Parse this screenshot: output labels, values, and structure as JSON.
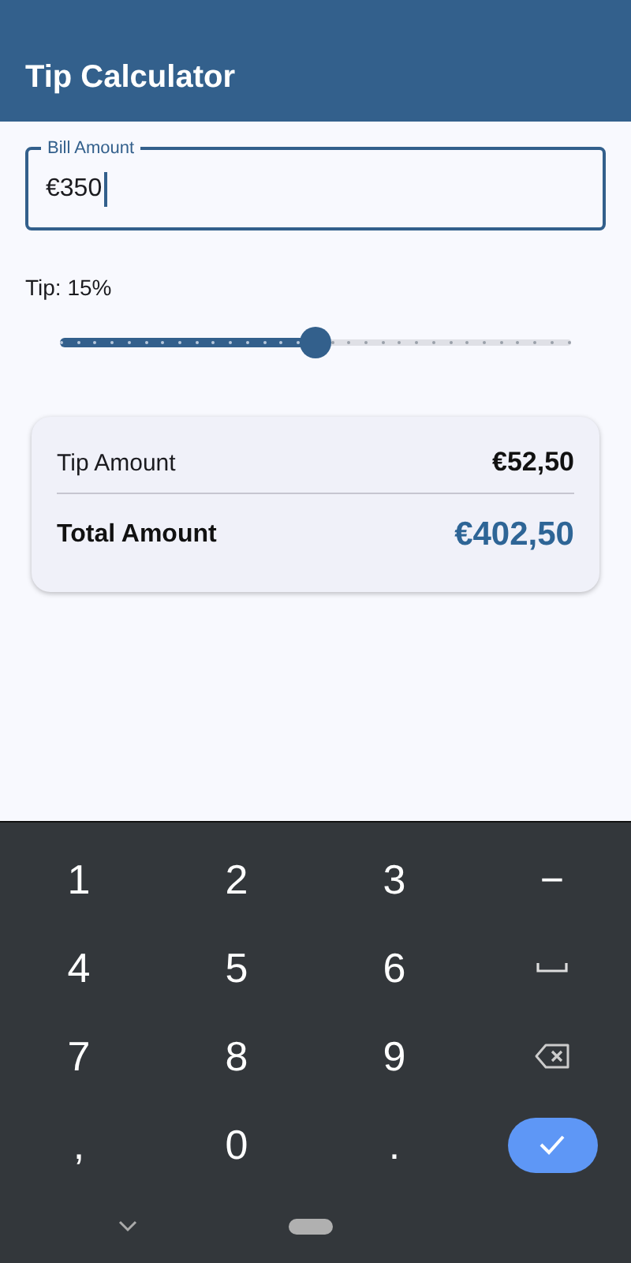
{
  "app_bar": {
    "title": "Tip Calculator"
  },
  "bill_field": {
    "label": "Bill Amount",
    "value": "€350",
    "focused": true
  },
  "tip": {
    "label": "Tip: 15%",
    "slider": {
      "level": 0.5
    }
  },
  "summary": {
    "rows": [
      {
        "kind": "regular",
        "label": "Tip Amount",
        "value": "€52,50"
      },
      {
        "kind": "total",
        "label": "Total Amount",
        "value": "€402,50"
      }
    ]
  },
  "keyboard": {
    "keys": [
      {
        "kind": "char",
        "label": "1"
      },
      {
        "kind": "char",
        "label": "2"
      },
      {
        "kind": "char",
        "label": "3"
      },
      {
        "kind": "char",
        "label": "−"
      },
      {
        "kind": "char",
        "label": "4"
      },
      {
        "kind": "char",
        "label": "5"
      },
      {
        "kind": "char",
        "label": "6"
      },
      {
        "kind": "space"
      },
      {
        "kind": "char",
        "label": "7"
      },
      {
        "kind": "char",
        "label": "8"
      },
      {
        "kind": "char",
        "label": "9"
      },
      {
        "kind": "backspace"
      },
      {
        "kind": "char",
        "label": ","
      },
      {
        "kind": "char",
        "label": "0"
      },
      {
        "kind": "char",
        "label": "."
      },
      {
        "kind": "done"
      }
    ]
  }
}
